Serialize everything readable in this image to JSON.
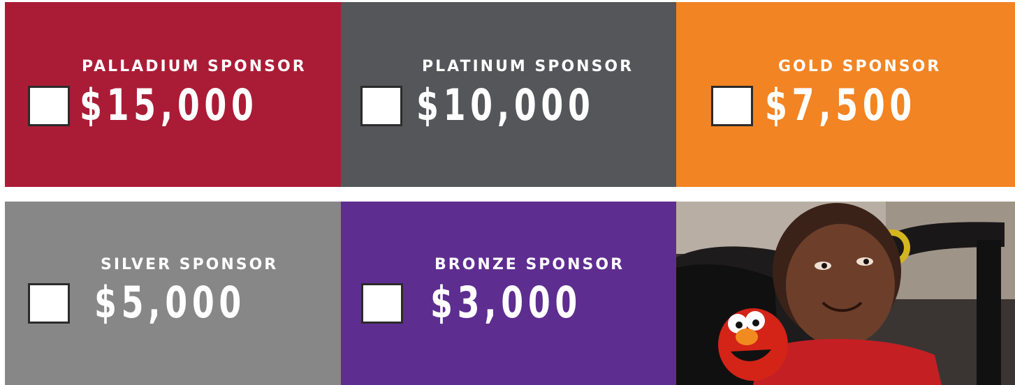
{
  "sponsors": [
    {
      "tier_label": "PALLADIUM SPONSOR",
      "amount": "$15,000",
      "checked": false,
      "color": "#aa1c36"
    },
    {
      "tier_label": "PLATINUM SPONSOR",
      "amount": "$10,000",
      "checked": false,
      "color": "#555659"
    },
    {
      "tier_label": "GOLD SPONSOR",
      "amount": "$7,500",
      "checked": false,
      "color": "#f28423"
    },
    {
      "tier_label": "SILVER SPONSOR",
      "amount": "$5,000",
      "checked": false,
      "color": "#878787"
    },
    {
      "tier_label": "BRONZE SPONSOR",
      "amount": "$3,000",
      "checked": false,
      "color": "#5e2d90"
    }
  ],
  "photo": {
    "description_icon": "child-with-toy-photo"
  }
}
